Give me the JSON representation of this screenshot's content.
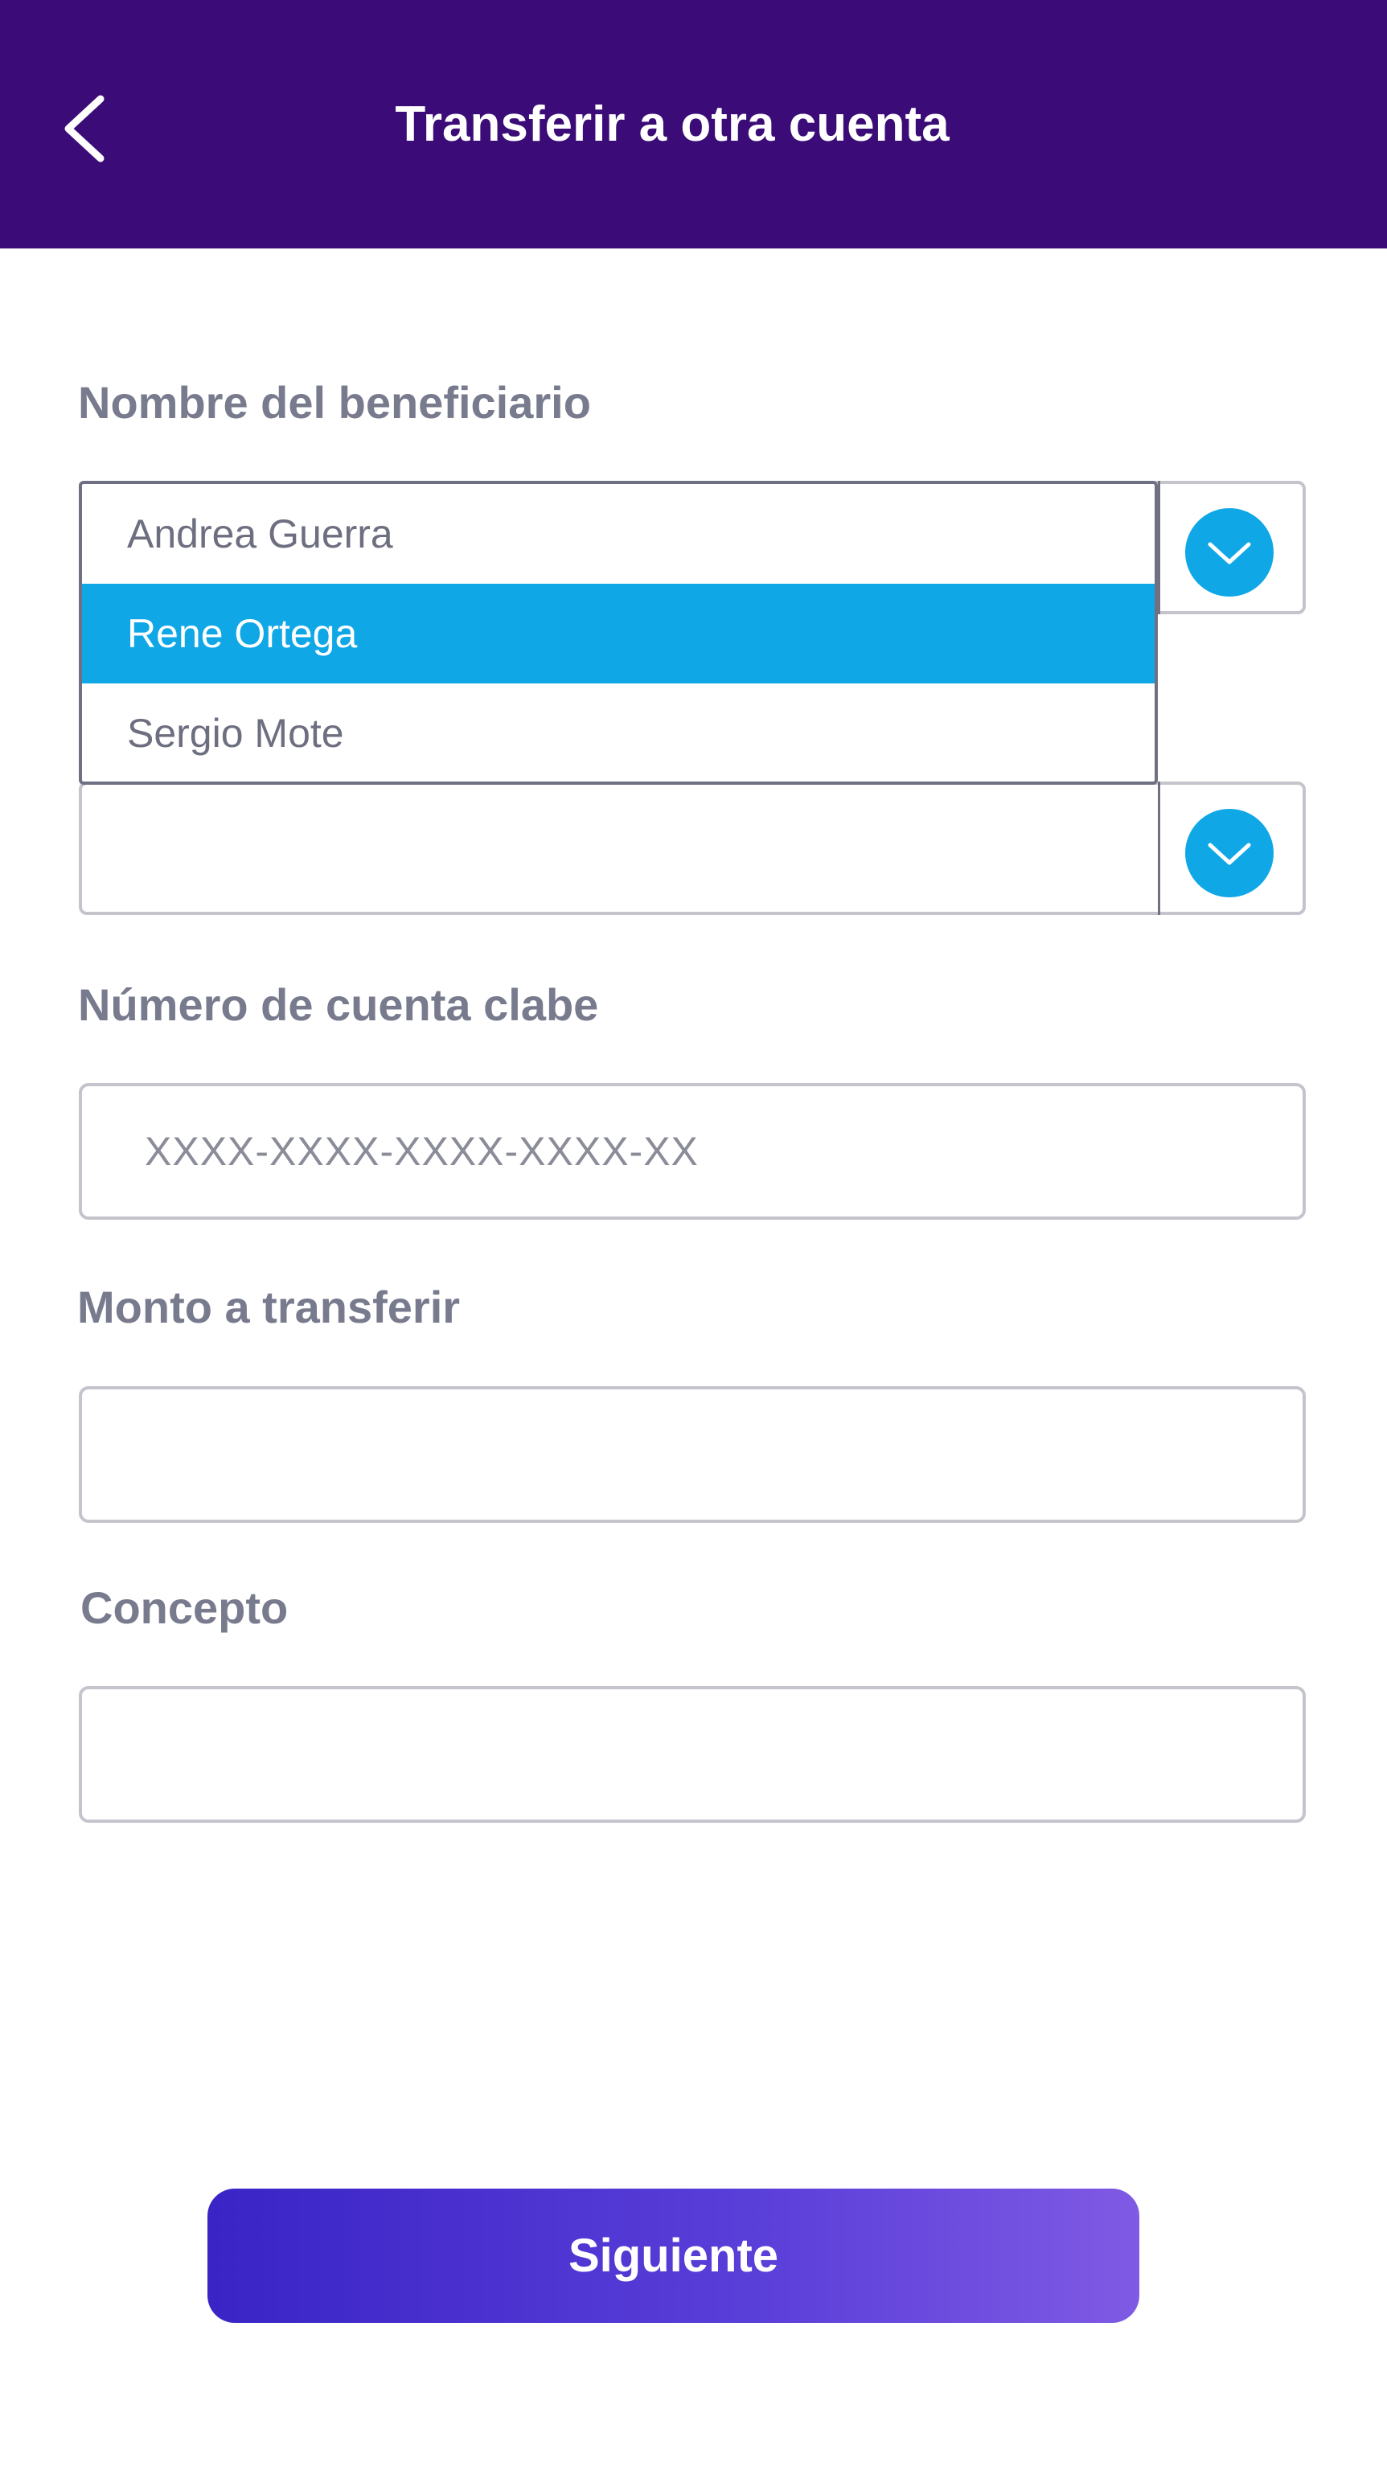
{
  "header": {
    "title": "Transferir a otra cuenta",
    "background_color": "#3b0c77"
  },
  "form": {
    "beneficiary_label": "Nombre del beneficiario",
    "beneficiary_options": [
      "Andrea Guerra",
      "Rene Ortega",
      "Sergio Mote"
    ],
    "beneficiary_selected": "Rene Ortega",
    "account_label": "Número de cuenta clabe",
    "account_placeholder": "XXXX-XXXX-XXXX-XXXX-XX",
    "amount_label": "Monto a transferir",
    "concept_label": "Concepto"
  },
  "footer": {
    "next_label": "Siguiente"
  },
  "colors": {
    "accent": "#0fa7e6",
    "label": "#787b8d",
    "button_gradient_start": "#3a24c6",
    "button_gradient_end": "#7f5ae4"
  },
  "icons": {
    "back": "chevron-left-icon",
    "dropdown": "chevron-down-icon"
  }
}
